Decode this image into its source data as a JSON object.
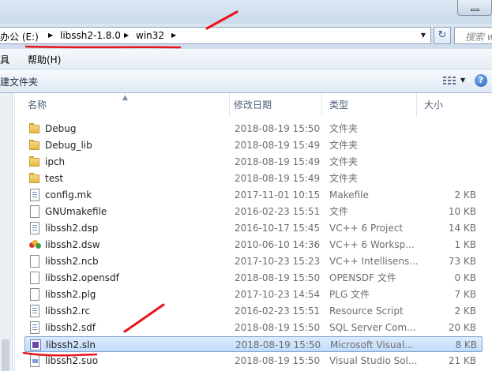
{
  "address": {
    "crumbs": [
      "办公 (E:)",
      "libssh2-1.8.0",
      "win32"
    ],
    "search_placeholder": "搜索 wi"
  },
  "menu": {
    "items": [
      "具",
      "帮助(H)"
    ]
  },
  "toolbar": {
    "new_folder": "建文件夹"
  },
  "columns": {
    "name": "名称",
    "date": "修改日期",
    "type": "类型",
    "size": "大小"
  },
  "files": [
    {
      "name": "Debug",
      "date": "2018-08-19 15:50",
      "type": "文件夹",
      "size": "",
      "icon": "folder-icon"
    },
    {
      "name": "Debug_lib",
      "date": "2018-08-19 15:49",
      "type": "文件夹",
      "size": "",
      "icon": "folder-icon"
    },
    {
      "name": "ipch",
      "date": "2018-08-19 15:49",
      "type": "文件夹",
      "size": "",
      "icon": "folder-icon"
    },
    {
      "name": "test",
      "date": "2018-08-19 15:49",
      "type": "文件夹",
      "size": "",
      "icon": "folder-icon"
    },
    {
      "name": "config.mk",
      "date": "2017-11-01 10:15",
      "type": "Makefile",
      "size": "2 KB",
      "icon": "mk-file-icon"
    },
    {
      "name": "GNUmakefile",
      "date": "2016-02-23 15:51",
      "type": "文件",
      "size": "10 KB",
      "icon": "blank-file-icon"
    },
    {
      "name": "libssh2.dsp",
      "date": "2016-10-17 15:45",
      "type": "VC++ 6 Project",
      "size": "14 KB",
      "icon": "dsp-file-icon"
    },
    {
      "name": "libssh2.dsw",
      "date": "2010-06-10 14:36",
      "type": "VC++ 6 Worksp...",
      "size": "1 KB",
      "icon": "dsw-file-icon"
    },
    {
      "name": "libssh2.ncb",
      "date": "2017-10-23 15:23",
      "type": "VC++ Intellisens...",
      "size": "73 KB",
      "icon": "blank-file-icon"
    },
    {
      "name": "libssh2.opensdf",
      "date": "2018-08-19 15:50",
      "type": "OPENSDF 文件",
      "size": "0 KB",
      "icon": "blank-file-icon"
    },
    {
      "name": "libssh2.plg",
      "date": "2017-10-23 14:54",
      "type": "PLG 文件",
      "size": "7 KB",
      "icon": "blank-file-icon"
    },
    {
      "name": "libssh2.rc",
      "date": "2016-02-23 15:51",
      "type": "Resource Script",
      "size": "2 KB",
      "icon": "rc-file-icon"
    },
    {
      "name": "libssh2.sdf",
      "date": "2018-08-19 15:50",
      "type": "SQL Server Com...",
      "size": "20 KB",
      "icon": "sdf-file-icon"
    },
    {
      "name": "libssh2.sln",
      "date": "2018-08-19 15:50",
      "type": "Microsoft Visual...",
      "size": "8 KB",
      "icon": "sln-file-icon",
      "selected": true
    },
    {
      "name": "libssh2.suo",
      "date": "2018-08-19 15:50",
      "type": "Visual Studio Sol...",
      "size": "21 KB",
      "icon": "suo-file-icon"
    }
  ],
  "annotation_color": "#e8141b"
}
